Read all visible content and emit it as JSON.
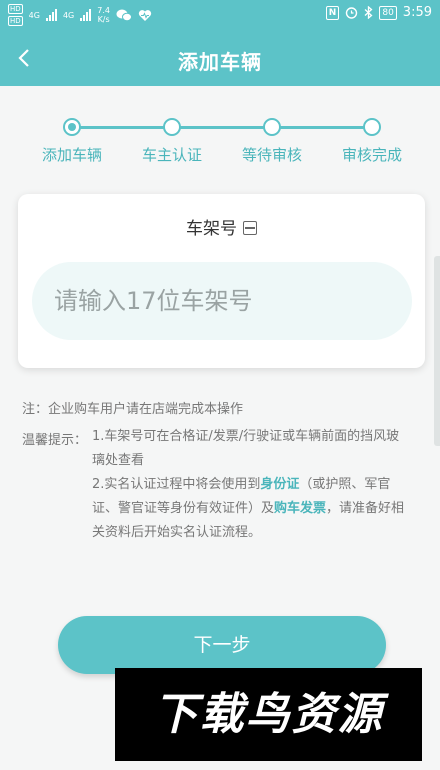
{
  "status_bar": {
    "hd1": "HD",
    "hd2": "HD",
    "net1": "4G",
    "net2": "4G",
    "speed_value": "7.4",
    "speed_unit": "K/s",
    "nfc": "N",
    "battery": "80",
    "time": "3:59"
  },
  "nav": {
    "title": "添加车辆"
  },
  "stepper": {
    "steps": [
      {
        "label": "添加车辆",
        "active": true
      },
      {
        "label": "车主认证",
        "active": false
      },
      {
        "label": "等待审核",
        "active": false
      },
      {
        "label": "审核完成",
        "active": false
      }
    ]
  },
  "form": {
    "label": "车架号",
    "vin_placeholder": "请输入17位车架号",
    "vin_value": ""
  },
  "notes": {
    "note": "注：企业购车用户请在店端完成本操作",
    "tips_label": "温馨提示：",
    "tip1": "1.车架号可在合格证/发票/行驶证或车辆前面的挡风玻璃处查看",
    "tip2_pre": "2.实名认证过程中将会使用到",
    "tip2_hl1": "身份证",
    "tip2_mid": "（或护照、军官证、警官证等身份有效证件）及",
    "tip2_hl2": "购车发票",
    "tip2_post": "，请准备好相关资料后开始实名认证流程。"
  },
  "actions": {
    "next_label": "下一步"
  },
  "watermark": {
    "text": "下载鸟资源"
  },
  "colors": {
    "accent": "#5cc3c8",
    "accent_text": "#4ab5bb",
    "background": "#f5f6f6"
  },
  "icons": [
    "back-arrow-icon",
    "scan-icon",
    "wechat-icon",
    "heart-icon",
    "nfc-icon",
    "alarm-icon",
    "bluetooth-icon",
    "battery-icon"
  ]
}
